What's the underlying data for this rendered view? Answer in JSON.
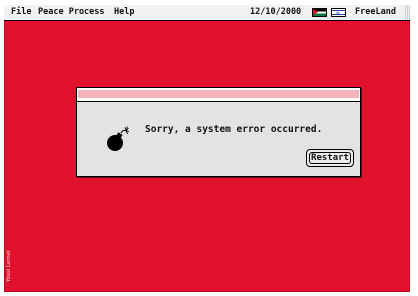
{
  "menubar": {
    "items": [
      "File",
      "Peace Process",
      "Help"
    ],
    "date": "12/10/2000",
    "app_name": "FreeLand"
  },
  "dialog": {
    "icon": "bomb-icon",
    "message": "Sorry, a system error occurred.",
    "button_label": "Restart"
  },
  "signature": "Yossi Lemel",
  "colors": {
    "background": "#e2112e",
    "menubar": "#f2f2f2",
    "dialog": "#e3e3e3",
    "stripe": "#f3b3ba"
  }
}
